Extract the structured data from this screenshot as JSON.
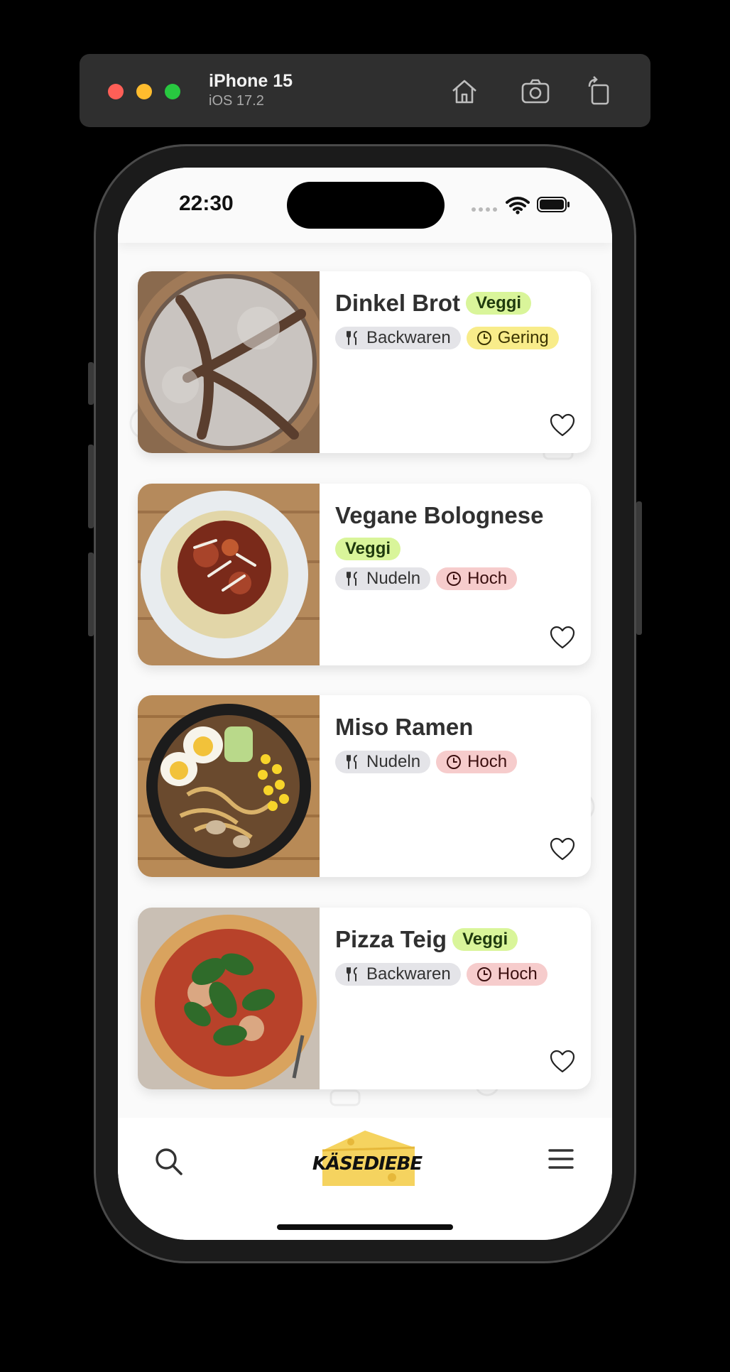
{
  "simulator": {
    "device_name": "iPhone 15",
    "os_version": "iOS 17.2",
    "buttons": [
      "home-icon",
      "screenshot-icon",
      "rotate-icon"
    ]
  },
  "status_bar": {
    "time": "22:30"
  },
  "recipes": [
    {
      "title": "Dinkel Brot",
      "veggi": "Veggi",
      "category": "Backwaren",
      "effort": "Gering",
      "effort_color": "#f8ec8a",
      "image": "bread-photo"
    },
    {
      "title": "Vegane Bolognese",
      "veggi": "Veggi",
      "category": "Nudeln",
      "effort": "Hoch",
      "effort_color": "#f6cccc",
      "image": "bolognese-photo"
    },
    {
      "title": "Miso Ramen",
      "veggi": null,
      "category": "Nudeln",
      "effort": "Hoch",
      "effort_color": "#f6cccc",
      "image": "ramen-photo"
    },
    {
      "title": "Pizza Teig",
      "veggi": "Veggi",
      "category": "Backwaren",
      "effort": "Hoch",
      "effort_color": "#f6cccc",
      "image": "pizza-photo"
    }
  ],
  "tab_bar": {
    "logo_text": "KÄSEDIEBE",
    "left_icon": "search-icon",
    "right_icon": "hamburger-menu-icon"
  },
  "colors": {
    "veggi_chip": "#d9f59a",
    "category_chip": "#e4e4e8",
    "effort_low": "#f8ec8a",
    "effort_high": "#f6cccc",
    "logo_cheese": "#f5d35f"
  }
}
